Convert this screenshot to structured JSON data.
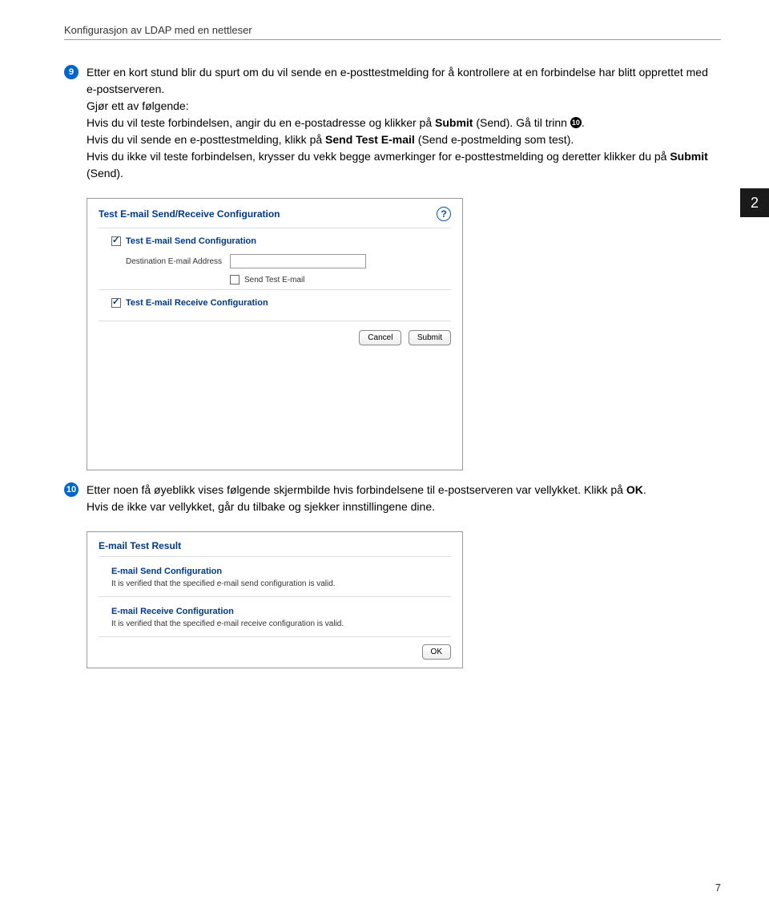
{
  "header": {
    "title": "Konfigurasjon av LDAP med en nettleser"
  },
  "sideTab": "2",
  "pageNumber": "7",
  "step9": {
    "num": "9",
    "line1": "Etter en kort stund blir du spurt om du vil sende en e-posttestmelding for å kontrollere at en forbindelse har blitt opprettet med e-postserveren.",
    "line2": "Gjør ett av følgende:",
    "line3a": "Hvis du vil teste forbindelsen, angir du en e-postadresse og klikker på ",
    "bold1": "Submit",
    "line3b": " (Send). Gå til trinn ",
    "inlineNum": "10",
    "line3c": ".",
    "line4a": "Hvis du vil sende en e-posttestmelding, klikk på ",
    "bold2": "Send Test E-mail",
    "line4b": " (Send e-postmelding som test).",
    "line5a": "Hvis du ikke vil teste forbindelsen, krysser du vekk begge avmerkinger for e-posttestmelding og deretter klikker du på ",
    "bold3": "Submit",
    "line5b": " (Send)."
  },
  "screenshot1": {
    "title": "Test E-mail Send/Receive Configuration",
    "sendConfigLabel": "Test E-mail Send Configuration",
    "destLabel": "Destination E-mail Address",
    "sendTestLabel": "Send Test E-mail",
    "receiveConfigLabel": "Test E-mail Receive Configuration",
    "cancelBtn": "Cancel",
    "submitBtn": "Submit"
  },
  "step10": {
    "num": "10",
    "line1a": "Etter noen få øyeblikk vises følgende skjermbilde hvis forbindelsene til e-postserveren var vellykket. Klikk på ",
    "bold1": "OK",
    "line1b": ".",
    "line2": "Hvis de ikke var vellykket, går du tilbake og sjekker innstillingene dine."
  },
  "screenshot2": {
    "title": "E-mail Test Result",
    "sendTitle": "E-mail Send Configuration",
    "sendText": "It is verified that the specified e-mail send configuration is valid.",
    "recvTitle": "E-mail Receive Configuration",
    "recvText": "It is verified that the specified e-mail receive configuration is valid.",
    "okBtn": "OK"
  }
}
